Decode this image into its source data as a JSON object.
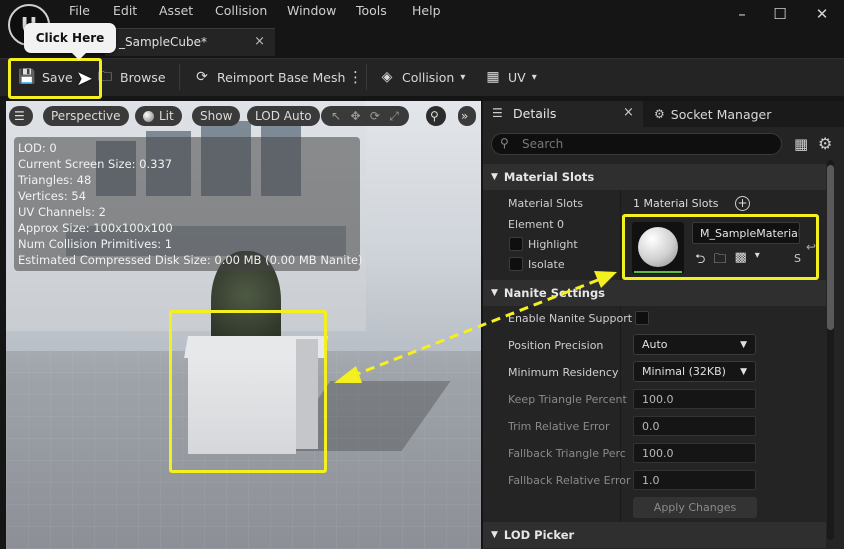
{
  "menu": [
    "File",
    "Edit",
    "Asset",
    "Collision",
    "Window",
    "Tools",
    "Help"
  ],
  "document_tab": {
    "label": "_SampleCube*",
    "close": "×"
  },
  "tooltip": "Click Here",
  "toolbar": {
    "save": "Save",
    "browse": "Browse",
    "reimport": "Reimport Base Mesh",
    "more": "⋮",
    "collision": "Collision",
    "uv": "UV"
  },
  "viewport": {
    "buttons": {
      "menu": "☰",
      "perspective": "Perspective",
      "lit": "Lit",
      "show": "Show",
      "lod": "LOD Auto",
      "more": "»"
    },
    "stats": [
      "LOD:  0",
      "Current Screen Size:  0.337",
      "Triangles:  48",
      "Vertices:  54",
      "UV Channels:  2",
      "Approx Size: 100x100x100",
      "Num Collision Primitives:  1",
      "Estimated Compressed Disk Size: 0.00 MB (0.00 MB Nanite)"
    ]
  },
  "details": {
    "tab_details": "Details",
    "tab_close": "×",
    "tab_socket": "Socket Manager",
    "search_placeholder": "Search",
    "material_slots_section": "Material Slots",
    "material_slots_label": "Material Slots",
    "material_slots_value": "1 Material Slots",
    "element_label": "Element 0",
    "highlight_label": "Highlight",
    "isolate_label": "Isolate",
    "material_name": "M_SampleMaterial",
    "material_extra": "S",
    "nanite_section": "Nanite Settings",
    "enable_nanite": "Enable Nanite Support",
    "position_precision_label": "Position Precision",
    "position_precision_value": "Auto",
    "min_residency_label": "Minimum Residency",
    "min_residency_value": "Minimal (32KB)",
    "keep_triangle_label": "Keep Triangle Percent",
    "keep_triangle_value": "100.0",
    "trim_relative_label": "Trim Relative Error",
    "trim_relative_value": "0.0",
    "fallback_triangle_label": "Fallback Triangle Perc",
    "fallback_triangle_value": "100.0",
    "fallback_relative_label": "Fallback Relative Error",
    "fallback_relative_value": "1.0",
    "apply_changes": "Apply Changes",
    "lod_picker_section": "LOD Picker"
  },
  "colors": {
    "highlight": "#f4f020",
    "panel": "#242424",
    "background": "#151515"
  }
}
